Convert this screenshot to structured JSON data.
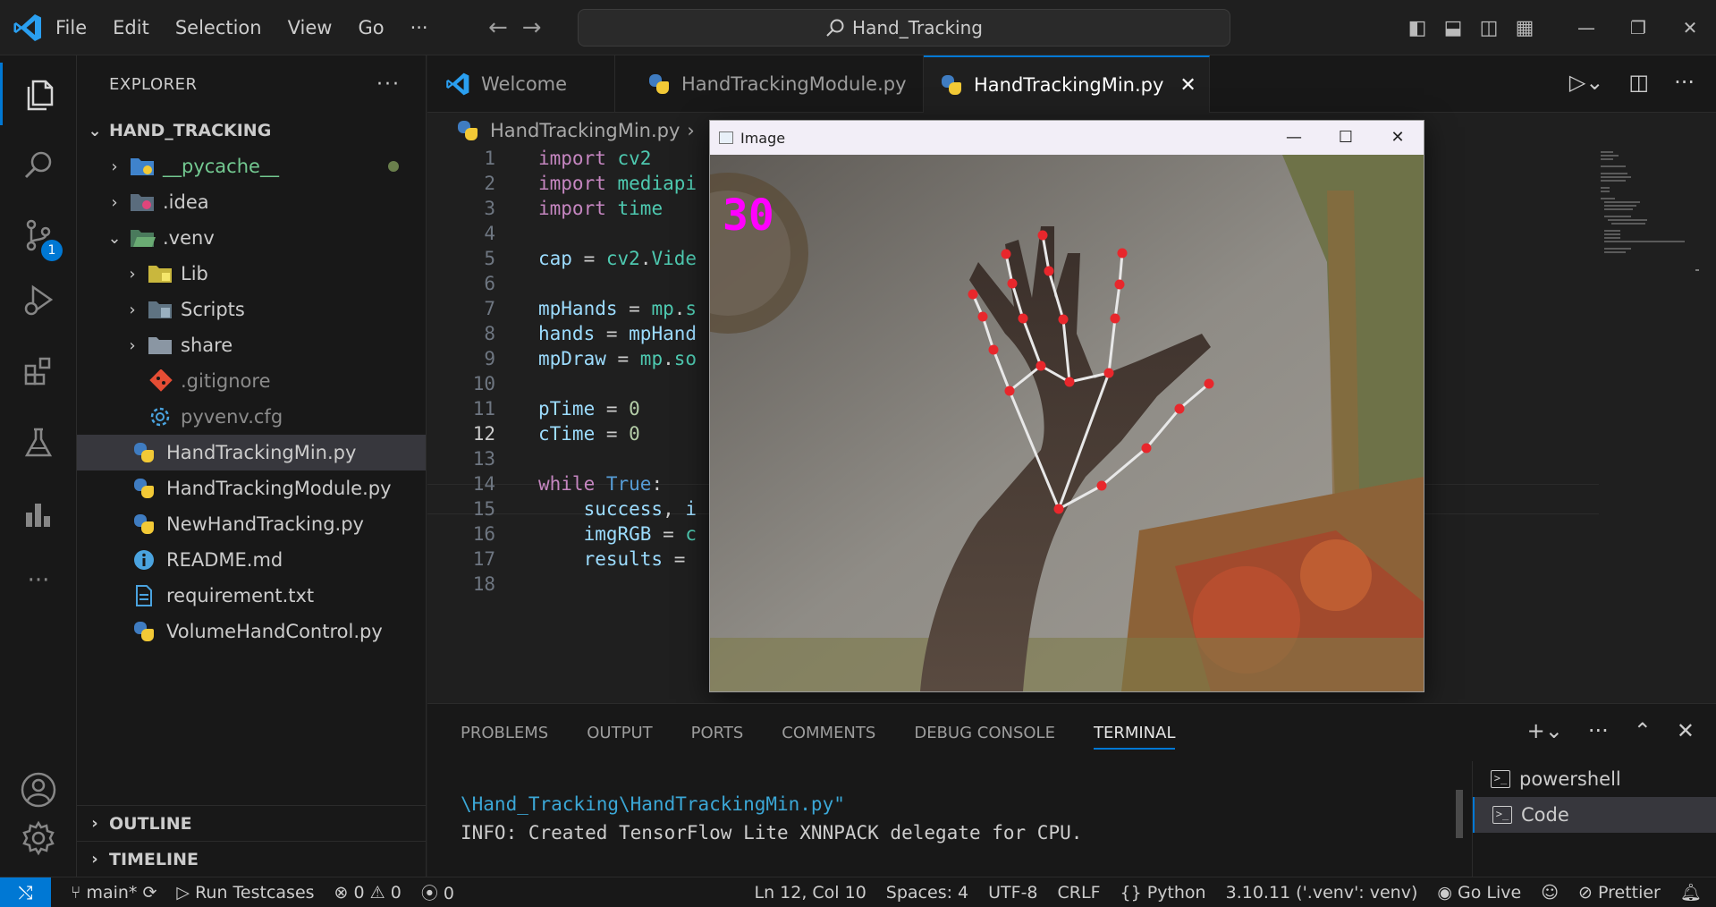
{
  "titlebar": {
    "menu": [
      "File",
      "Edit",
      "Selection",
      "View",
      "Go"
    ],
    "more": "···",
    "search_text": "Hand_Tracking"
  },
  "activity": {
    "scm_badge": "1"
  },
  "explorer": {
    "header": "EXPLORER",
    "more": "···",
    "root": "HAND_TRACKING",
    "items": [
      {
        "label": "__pycache__",
        "color": "#73c991",
        "type": "folder"
      },
      {
        "label": ".idea",
        "color": "#cccccc",
        "type": "folder"
      },
      {
        "label": ".venv",
        "color": "#cccccc",
        "type": "folder-open"
      },
      {
        "label": "Lib",
        "color": "#cccccc",
        "type": "folder"
      },
      {
        "label": "Scripts",
        "color": "#cccccc",
        "type": "folder"
      },
      {
        "label": "share",
        "color": "#cccccc",
        "type": "folder"
      },
      {
        "label": ".gitignore",
        "color": "#8b8b8b",
        "type": "git"
      },
      {
        "label": "pyvenv.cfg",
        "color": "#8b8b8b",
        "type": "gear"
      },
      {
        "label": "HandTrackingMin.py",
        "color": "#cccccc",
        "type": "py"
      },
      {
        "label": "HandTrackingModule.py",
        "color": "#cccccc",
        "type": "py"
      },
      {
        "label": "NewHandTracking.py",
        "color": "#cccccc",
        "type": "py"
      },
      {
        "label": "README.md",
        "color": "#cccccc",
        "type": "info"
      },
      {
        "label": "requirement.txt",
        "color": "#cccccc",
        "type": "txt"
      },
      {
        "label": "VolumeHandControl.py",
        "color": "#cccccc",
        "type": "py"
      }
    ],
    "outline": "OUTLINE",
    "timeline": "TIMELINE"
  },
  "tabs": [
    {
      "label": "Welcome"
    },
    {
      "label": "HandTrackingModule.py"
    },
    {
      "label": "HandTrackingMin.py",
      "close": "✕"
    }
  ],
  "breadcrumb": {
    "file": "HandTrackingMin.py",
    "sep": "›"
  },
  "code": {
    "line_numbers": [
      "1",
      "2",
      "3",
      "4",
      "5",
      "6",
      "7",
      "8",
      "9",
      "10",
      "11",
      "12",
      "13",
      "14",
      "15",
      "16",
      "17",
      "18"
    ],
    "current_line": "12"
  },
  "image_window": {
    "title": "Image",
    "fps": "30",
    "min": "—",
    "max": "☐",
    "close": "✕"
  },
  "panel": {
    "tabs": [
      "PROBLEMS",
      "OUTPUT",
      "PORTS",
      "COMMENTS",
      "DEBUG CONSOLE",
      "TERMINAL"
    ],
    "terminal_lines": [
      "\\Hand_Tracking\\HandTrackingMin.py\"",
      "INFO: Created TensorFlow Lite XNNPACK delegate for CPU."
    ],
    "terminals": [
      "powershell",
      "Code"
    ]
  },
  "statusbar": {
    "branch": "main*",
    "run_testcases": "Run Testcases",
    "errors": "0",
    "warnings": "0",
    "ports": "0",
    "position": "Ln 12, Col 10",
    "spaces": "Spaces: 4",
    "encoding": "UTF-8",
    "eol": "CRLF",
    "language": "Python",
    "interpreter": "3.10.11 ('.venv': venv)",
    "go_live": "Go Live",
    "prettier": "Prettier"
  }
}
